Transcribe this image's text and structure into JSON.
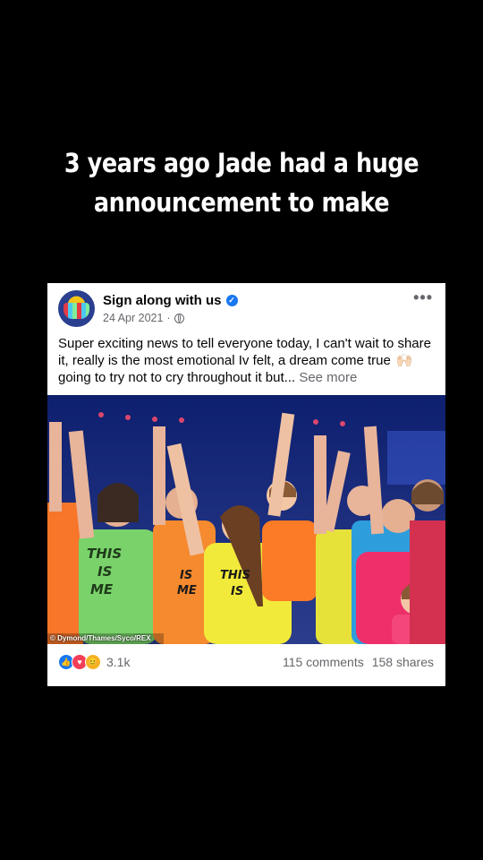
{
  "headline": {
    "line1": "3 years ago Jade had a huge",
    "line2": "announcement to make"
  },
  "post": {
    "page_name": "Sign along with us",
    "date": "24 Apr 2021",
    "separator": "·",
    "more_label": "•••",
    "text_part1": "Super exciting news to tell everyone today, I can't wait to share it, really is the most emotional Iv felt, a dream come true",
    "emoji": "🙌🏻",
    "text_part2": "going to try not to cry throughout it but...",
    "see_more": "See more",
    "photo_credit": "© Dymond/Thames/Syco/REX",
    "shirt_text": [
      "THIS",
      "IS",
      "ME"
    ],
    "reaction_count": "3.1k",
    "comments": "115 comments",
    "shares": "158 shares"
  },
  "icons": {
    "verified": "verified-badge-icon",
    "globe": "globe-icon",
    "reactions": [
      "like-icon",
      "love-icon",
      "care-icon"
    ]
  },
  "colors": {
    "background": "#000000",
    "accent": "#1877f2"
  }
}
